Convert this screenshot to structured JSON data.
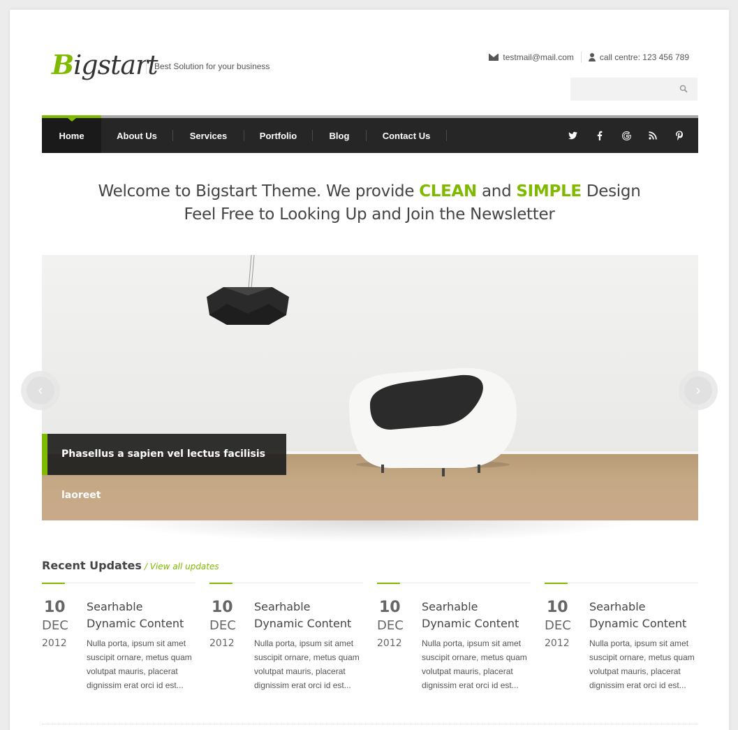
{
  "header": {
    "logo_first": "B",
    "logo_rest": "igstart",
    "tagline": "Best Solution for your business",
    "email": "testmail@mail.com",
    "phone": "call centre: 123 456 789",
    "search_placeholder": ""
  },
  "nav": {
    "items": [
      {
        "label": "Home",
        "active": true
      },
      {
        "label": "About Us"
      },
      {
        "label": "Services"
      },
      {
        "label": "Portfolio"
      },
      {
        "label": "Blog"
      },
      {
        "label": "Contact Us"
      }
    ],
    "socials": [
      {
        "icon": "twitter-icon",
        "glyph": "🐦"
      },
      {
        "icon": "facebook-icon",
        "glyph": "f"
      },
      {
        "icon": "google-icon",
        "glyph": "G"
      },
      {
        "icon": "rss-icon",
        "glyph": ")"
      },
      {
        "icon": "pinterest-icon",
        "glyph": "P"
      }
    ]
  },
  "welcome": {
    "line1_a": "Welcome to Bigstart Theme. We provide ",
    "line1_hl1": "CLEAN",
    "line1_b": " and ",
    "line1_hl2": "SIMPLE",
    "line1_c": " Design",
    "line2": "Feel Free to Looking Up and Join the Newsletter"
  },
  "slider": {
    "caption": "Phasellus a sapien vel lectus facilisis laoreet",
    "prev_glyph": "‹",
    "next_glyph": "›"
  },
  "recent": {
    "title": "Recent Updates",
    "link": "/ View all updates",
    "items": [
      {
        "day": "10",
        "month": "DEC",
        "year": "2012",
        "title": "Searhable Dynamic Content",
        "text": "Nulla porta, ipsum sit amet suscipit ornare, metus quam volutpat mauris, placerat dignissim erat orci id est..."
      },
      {
        "day": "10",
        "month": "DEC",
        "year": "2012",
        "title": "Searhable Dynamic Content",
        "text": "Nulla porta, ipsum sit amet suscipit ornare, metus quam volutpat mauris, placerat dignissim erat orci id est..."
      },
      {
        "day": "10",
        "month": "DEC",
        "year": "2012",
        "title": "Searhable Dynamic Content",
        "text": "Nulla porta, ipsum sit amet suscipit ornare, metus quam volutpat mauris, placerat dignissim erat orci id est..."
      },
      {
        "day": "10",
        "month": "DEC",
        "year": "2012",
        "title": "Searhable Dynamic Content",
        "text": "Nulla porta, ipsum sit amet suscipit ornare, metus quam volutpat mauris, placerat dignissim erat orci id est..."
      }
    ]
  },
  "colors": {
    "accent": "#7fba00",
    "nav_bg": "#262626"
  }
}
